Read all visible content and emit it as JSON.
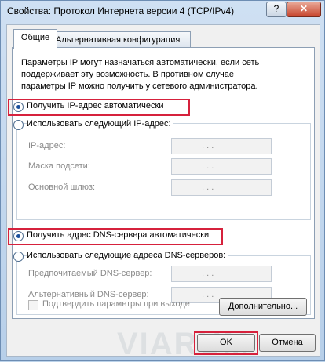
{
  "window": {
    "title": "Свойства: Протокол Интернета версии 4 (TCP/IPv4)",
    "help_label": "?",
    "close_label": "✕"
  },
  "tabs": [
    {
      "label": "Общие",
      "active": true
    },
    {
      "label": "Альтернативная конфигурация",
      "active": false
    }
  ],
  "description": "Параметры IP могут назначаться автоматически, если сеть поддерживает эту возможность. В противном случае параметры IP можно получить у сетевого администратора.",
  "ip_mode": {
    "auto_label": "Получить IP-адрес автоматически",
    "manual_label": "Использовать следующий IP-адрес:",
    "selected": "auto"
  },
  "ip_fields": [
    {
      "label": "IP-адрес:",
      "value": ". . ."
    },
    {
      "label": "Маска подсети:",
      "value": ". . ."
    },
    {
      "label": "Основной шлюз:",
      "value": ". . ."
    }
  ],
  "dns_mode": {
    "auto_label": "Получить адрес DNS-сервера автоматически",
    "manual_label": "Использовать следующие адреса DNS-серверов:",
    "selected": "auto"
  },
  "dns_fields": [
    {
      "label": "Предпочитаемый DNS-сервер:",
      "value": ". . ."
    },
    {
      "label": "Альтернативный DNS-сервер:",
      "value": ". . ."
    }
  ],
  "validate_label": "Подтвердить параметры при выходе",
  "validate_checked": false,
  "advanced_label": "Дополнительно...",
  "ok_label": "OK",
  "cancel_label": "Отмена",
  "watermark": "VIARUM",
  "colors": {
    "highlight": "#d6213c",
    "selected_radio": "#1a4f9c"
  }
}
